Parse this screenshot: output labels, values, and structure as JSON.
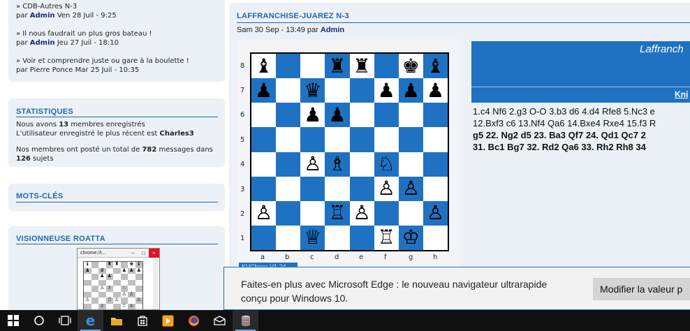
{
  "sidebar": {
    "posts": [
      {
        "title": "» CDB-Autres N-3",
        "by": "par",
        "author": "Admin",
        "date": "Ven 28 Juil - 9:25"
      },
      {
        "title": "» Il nous faudrait un plus gros bateau !",
        "by": "par",
        "author": "Admin",
        "date": "Jeu 27 Juil - 18:10"
      },
      {
        "title": "» Voir et comprendre juste ou gare à la boulette !",
        "by": "par",
        "author": "Pierre Ponce",
        "date": "Mar 25 Juil - 10:35"
      }
    ],
    "stats": {
      "title": "STATISTIQUES",
      "line1_pre": "Nous avons ",
      "members": "13",
      "line1_post": " membres enregistrés",
      "line2_pre": "L'utilisateur enregistré le plus récent est ",
      "newest": "Charles3",
      "line3_pre": "Nos membres ont posté un total de ",
      "messages": "782",
      "line3_mid": " messages dans",
      "subjects": "126",
      "line3_post": " sujets"
    },
    "keywords_title": "MOTS-CLÉS",
    "viewer_title": "VISIONNEUSE ROATTA",
    "mini_window_title": "chrome://i..."
  },
  "topic": {
    "title": "LAFFRANCHISE-JUAREZ N-3",
    "date": "Sam 30 Sep - 13:49",
    "by": "par",
    "author": "Admin"
  },
  "board": {
    "ranks": [
      "8",
      "7",
      "6",
      "5",
      "4",
      "3",
      "2",
      "1"
    ],
    "files": [
      "a",
      "b",
      "c",
      "d",
      "e",
      "f",
      "g",
      "h"
    ],
    "rows": [
      [
        "♝",
        "",
        "",
        "♜",
        "♜",
        "",
        "♚",
        "♝"
      ],
      [
        "♟",
        "",
        "♛",
        "",
        "",
        "♟",
        "♟",
        "♟"
      ],
      [
        "",
        "",
        "♟",
        "♟",
        "",
        "",
        "",
        ""
      ],
      [
        "",
        "",
        "",
        "",
        "",
        "",
        "",
        ""
      ],
      [
        "",
        "",
        "♙",
        "♗",
        "",
        "♘",
        "",
        ""
      ],
      [
        "",
        "",
        "",
        "",
        "",
        "♙",
        "♙",
        ""
      ],
      [
        "♙",
        "",
        "",
        "♖",
        "♙",
        "",
        "",
        "♙"
      ],
      [
        "",
        "",
        "♕",
        "",
        "",
        "♖",
        "♔",
        ""
      ]
    ],
    "tab_label": "KVChess V1.24"
  },
  "game": {
    "header_title": "Laffranch",
    "header_link": "Kni",
    "line1": "1.c4 Nf6 2.g3 O-O 3.b3 d6 4.d4 Rfe8 5.Nc3 e",
    "line2": "12.Bxf3 c6 13.Nf4 Qa6 14.Bxe4 Rxe4 15.f3 R",
    "line3": "g5 22.  Ng2 d5 23.  Ba3 Qf7 24.  Qd1 Qc7 2",
    "line4": "31.  Bc1 Bg7 32.  Rd2 Qa6 33.  Rh2 Rh8 34"
  },
  "toast": {
    "message_line1": "Faites-en plus avec Microsoft Edge : le nouveau navigateur ultrarapide",
    "message_line2": "conçu pour Windows 10.",
    "button": "Modifier la valeur p"
  },
  "taskbar": {
    "icons": [
      "windows-start-icon",
      "cortana-icon",
      "task-view-icon",
      "edge-icon",
      "file-explorer-icon",
      "store-icon",
      "media-player-icon",
      "firefox-icon",
      "mail-icon",
      "database-app-icon"
    ]
  }
}
